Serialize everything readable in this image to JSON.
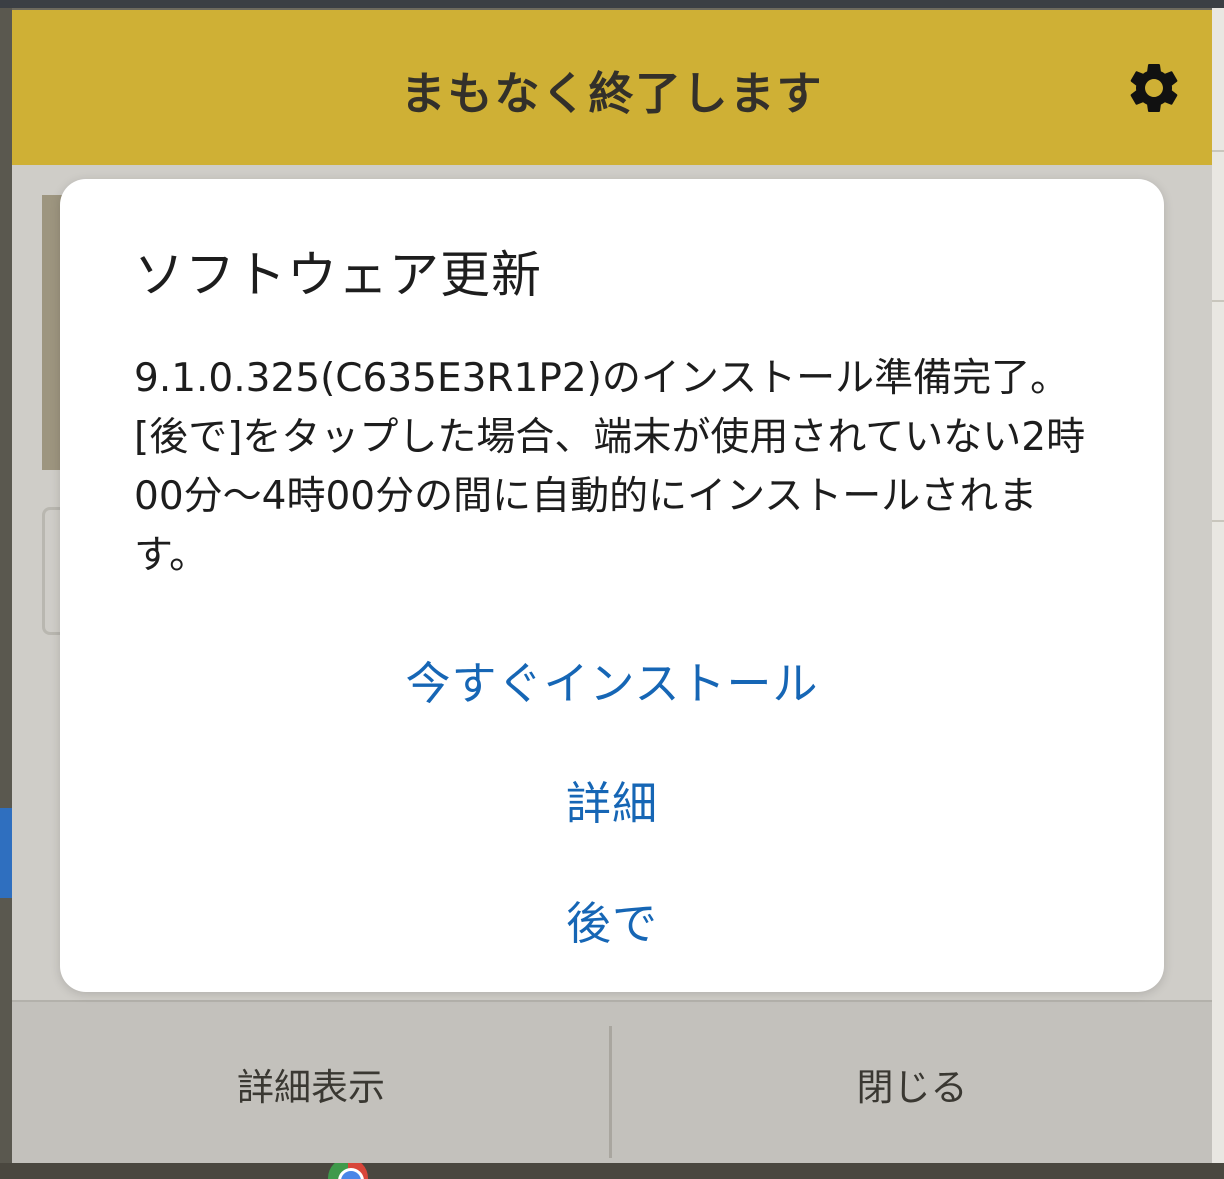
{
  "window": {
    "title": "まもなく終了します",
    "settings_icon": "gear-icon"
  },
  "dialog": {
    "title": "ソフトウェア更新",
    "message": "9.1.0.325(C635E3R1P2)のインストール準備完了。[後で]をタップした場合、端末が使用されていない2時00分～4時00分の間に自動的にインストールされます。",
    "install_now_label": "今すぐインストール",
    "details_label": "詳細",
    "later_label": "後で"
  },
  "footer": {
    "show_details_label": "詳細表示",
    "close_label": "閉じる"
  },
  "colors": {
    "title_bar": "#cfb035",
    "dialog_button_text": "#1666b5",
    "footer_background": "#c3c1bc"
  }
}
